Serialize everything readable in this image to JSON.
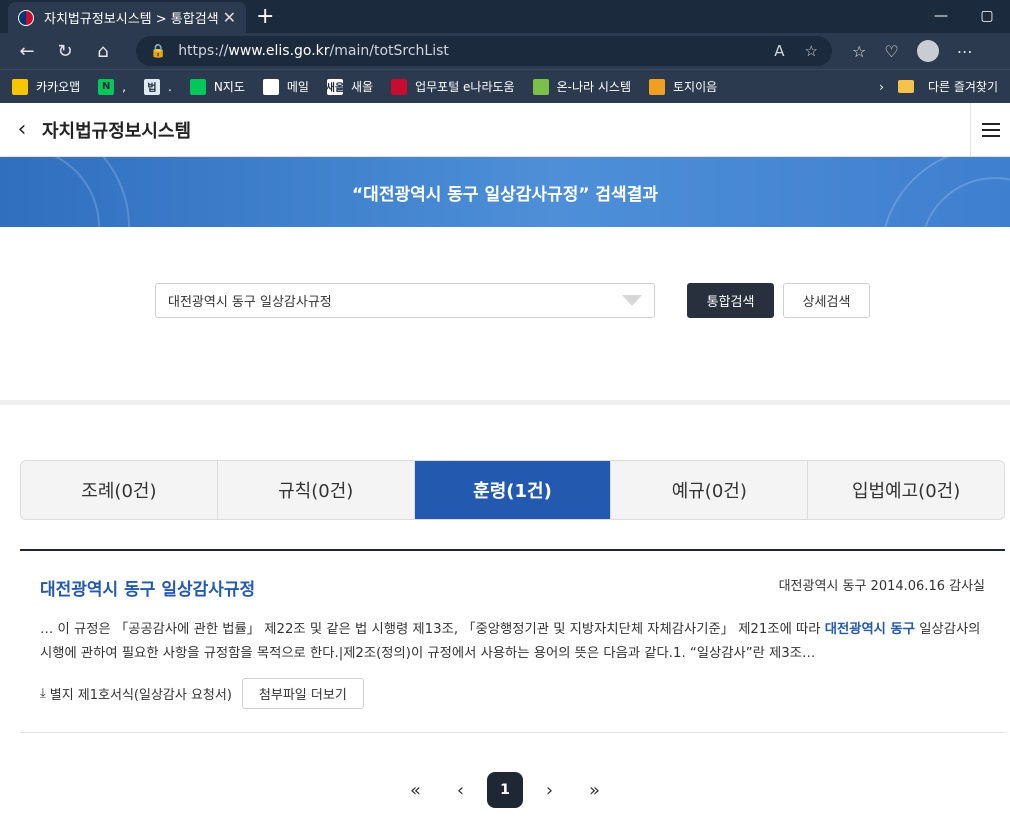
{
  "browser": {
    "tab_title": "자치법규정보시스템 > 통합검색",
    "url_prefix": "https://",
    "url_host": "www.elis.go.kr",
    "url_path": "/main/totSrchList",
    "bookmarks": [
      {
        "label": "카카오맵",
        "icon_color": "#f7c600",
        "icon": "pin-icon"
      },
      {
        "label": ",",
        "icon_color": "#03c75a",
        "icon": "naver-icon",
        "icon_text": "N"
      },
      {
        "label": ".",
        "icon_color": "#dfe8f5",
        "icon": "law-icon",
        "icon_text": "법"
      },
      {
        "label": "N지도",
        "icon_color": "#03c75a",
        "icon": "map-icon"
      },
      {
        "label": "메일",
        "icon_color": "#ffffff",
        "icon": "mail-icon"
      },
      {
        "label": "새올",
        "icon_color": "#ffffff",
        "icon": "saeol-icon",
        "icon_text": "새올"
      },
      {
        "label": "업무포털 e나라도움",
        "icon_color": "#c60c30",
        "icon": "taegeuk-icon"
      },
      {
        "label": "온-나라 시스템",
        "icon_color": "#7cc04a",
        "icon": "onnara-icon"
      },
      {
        "label": "토지이음",
        "icon_color": "#f0a020",
        "icon": "house-icon"
      }
    ],
    "other_bookmarks": "다른 즐겨찾기"
  },
  "header": {
    "site_title": "자치법규정보시스템"
  },
  "banner": {
    "title": "“대전광역시 동구 일상감사규정” 검색결과"
  },
  "search": {
    "query": "대전광역시 동구 일상감사규정",
    "search_button": "통합검색",
    "detail_button": "상세검색"
  },
  "tabs": [
    {
      "label": "조례(0건)",
      "active": false
    },
    {
      "label": "규칙(0건)",
      "active": false
    },
    {
      "label": "훈령(1건)",
      "active": true
    },
    {
      "label": "예규(0건)",
      "active": false
    },
    {
      "label": "입법예고(0건)",
      "active": false
    }
  ],
  "results": [
    {
      "title": "대전광역시 동구 일상감사규정",
      "meta": "대전광역시 동구 2014.06.16 감사실",
      "body_pre": "… 이 규정은 「공공감사에 관한 법률」 제22조 및 같은 법 시행령 제13조, 「중앙행정기관 및 지방자치단체 자체감사기준」 제21조에 따라 ",
      "body_highlight": "대전광역시 동구",
      "body_post": " 일상감사의 시행에 관하여 필요한 사항을 규정함을 목적으로 한다.|제2조(정의)이 규정에서 사용하는 용어의 뜻은 다음과 같다.1. “일상감사”란 제3조…",
      "attachment": "별지 제1호서식(일상감사 요청서)",
      "more_button": "첨부파일 더보기"
    }
  ],
  "pager": {
    "first": "«",
    "prev": "‹",
    "current": "1",
    "next": "›",
    "last": "»"
  }
}
